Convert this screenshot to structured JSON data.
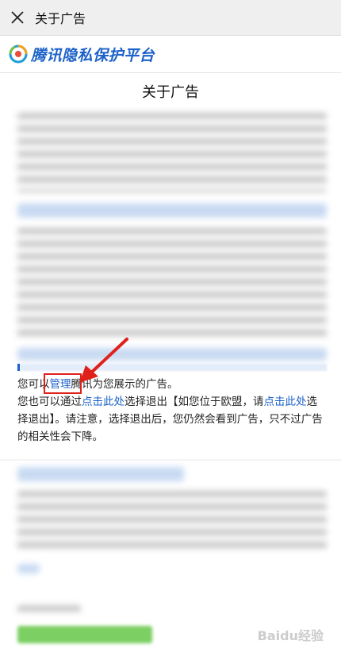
{
  "topbar": {
    "title": "关于广告"
  },
  "brand": {
    "name": "腾讯隐私保护平台"
  },
  "page": {
    "title": "关于广告"
  },
  "paragraph1": {
    "prefix": "您可以",
    "link_manage": "管理",
    "suffix": "腾讯为您展示的广告。"
  },
  "paragraph2": {
    "part1": "您也可以通过",
    "link1": "点击此处",
    "part2": "选择退出【如您位于欧盟，请",
    "link2": "点击此处",
    "part3": "选择退出】。请注意，选择退出后，您仍然会看到广告，只不过广告的相关性会下降。"
  },
  "watermark": {
    "text": "Baidu经验"
  },
  "colors": {
    "accent": "#1c62c8",
    "highlight": "#e0211b",
    "button": "#7ccf63"
  }
}
